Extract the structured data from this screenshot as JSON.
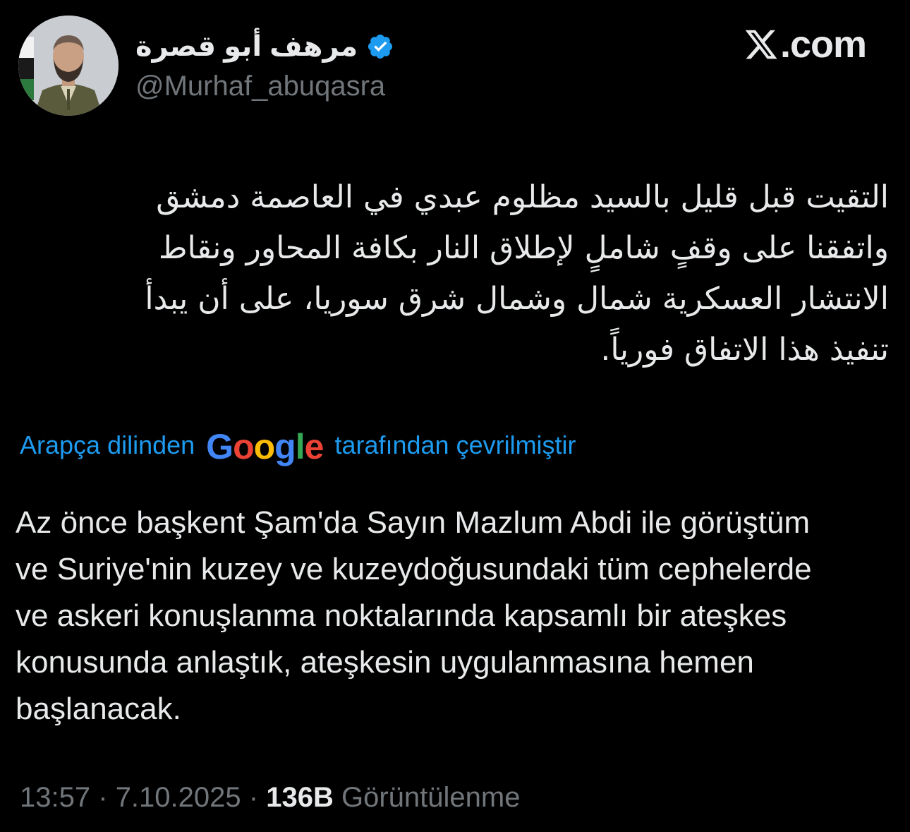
{
  "author": {
    "display_name": "مرهف أبو قصرة",
    "handle": "@Murhaf_abuqasra",
    "verified_color": "#1d9bf0"
  },
  "brand": {
    "label": ".com"
  },
  "tweet": {
    "original_lines": [
      "التقيت قبل قليل بالسيد مظلوم عبدي في العاصمة دمشق",
      "واتفقنا على وقفٍ شاملٍ لإطلاق النار بكافة المحاور ونقاط",
      "الانتشار العسكرية شمال وشمال شرق سوريا، على أن يبدأ",
      "تنفيذ هذا الاتفاق فورياً."
    ],
    "translation_note": {
      "before": "Arapça dilinden",
      "google": [
        "G",
        "o",
        "o",
        "g",
        "l",
        "e"
      ],
      "after": "tarafından çevrilmiştir",
      "google_colors": [
        "#4285F4",
        "#EA4335",
        "#FBBC05",
        "#4285F4",
        "#34A853",
        "#EA4335"
      ]
    },
    "translated_lines": [
      "Az önce başkent Şam'da Sayın Mazlum Abdi ile görüştüm",
      "ve Suriye'nin kuzey ve kuzeydoğusundaki tüm cephelerde",
      "ve askeri konuşlanma noktalarında kapsamlı bir ateşkes",
      "konusunda anlaştık, ateşkesin uygulanmasına hemen",
      "başlanacak."
    ]
  },
  "meta": {
    "time": "13:57",
    "separator": "·",
    "date": "7.10.2025",
    "views_count": "136B",
    "views_label": "Görüntülenme"
  },
  "colors": {
    "background": "#000000",
    "text": "#e7e9ea",
    "secondary": "#71767b",
    "accent": "#1d9bf0"
  }
}
